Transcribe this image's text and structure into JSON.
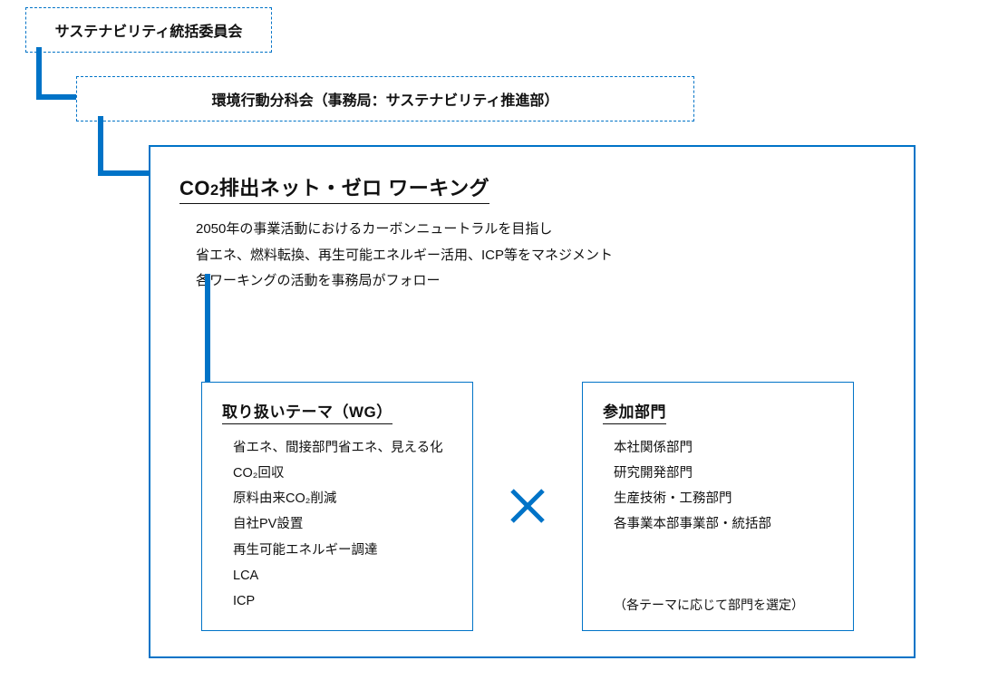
{
  "level1": {
    "title": "サステナビリティ統括委員会"
  },
  "level2": {
    "title": "環境行動分科会（事務局：サステナビリティ推進部）"
  },
  "outer": {
    "title_pre": "CO",
    "title_sub": "2",
    "title_post": "排出ネット・ゼロ ワーキング",
    "desc_line1": "2050年の事業活動におけるカーボンニュートラルを目指し",
    "desc_line2": "省エネ、燃料転換、再生可能エネルギー活用、ICP等をマネジメント",
    "desc_line3": "各ワーキングの活動を事務局がフォロー"
  },
  "themes": {
    "title": "取り扱いテーマ（WG）",
    "items": [
      "省エネ、間接部門省エネ、見える化",
      "CO₂回収",
      "原料由来CO₂削減",
      "自社PV設置",
      "再生可能エネルギー調達",
      "LCA",
      "ICP"
    ]
  },
  "departments": {
    "title": "参加部門",
    "items": [
      "本社関係部門",
      "研究開発部門",
      "生産技術・工務部門",
      "各事業本部事業部・統括部"
    ],
    "note": "（各テーマに応じて部門を選定）"
  }
}
